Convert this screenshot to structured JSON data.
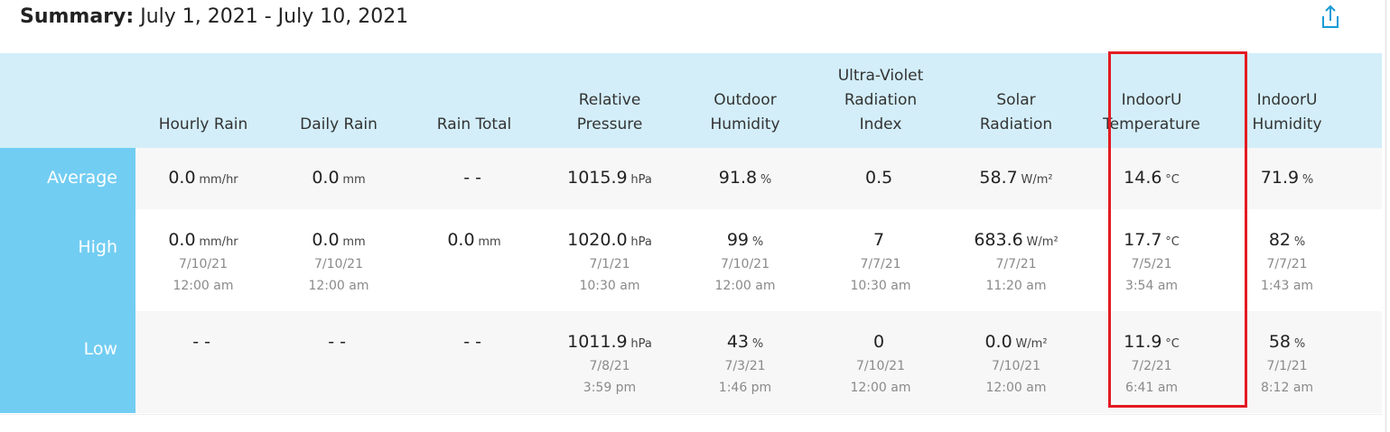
{
  "summary": {
    "label": "Summary:",
    "range": "July 1, 2021 - July 10, 2021",
    "share_icon": "share-icon"
  },
  "columns": [
    {
      "title": "Hourly Rain"
    },
    {
      "title": "Daily Rain"
    },
    {
      "title": "Rain Total"
    },
    {
      "title": "Relative Pressure"
    },
    {
      "title": "Outdoor Humidity"
    },
    {
      "title": "Ultra-Violet Radiation Index"
    },
    {
      "title": "Solar Radiation"
    },
    {
      "title": "IndoorU Temperature"
    },
    {
      "title": "IndoorU Humidity"
    }
  ],
  "rows": {
    "average": {
      "label": "Average",
      "cells": [
        {
          "value": "0.0",
          "unit": "mm/hr"
        },
        {
          "value": "0.0",
          "unit": "mm"
        },
        {
          "value": "- -",
          "unit": ""
        },
        {
          "value": "1015.9",
          "unit": "hPa"
        },
        {
          "value": "91.8",
          "unit": "%"
        },
        {
          "value": "0.5",
          "unit": ""
        },
        {
          "value": "58.7",
          "unit": "W/m²"
        },
        {
          "value": "14.6",
          "unit": "°C"
        },
        {
          "value": "71.9",
          "unit": "%"
        }
      ]
    },
    "high": {
      "label": "High",
      "cells": [
        {
          "value": "0.0",
          "unit": "mm/hr",
          "date": "7/10/21",
          "time": "12:00 am"
        },
        {
          "value": "0.0",
          "unit": "mm",
          "date": "7/10/21",
          "time": "12:00 am"
        },
        {
          "value": "0.0",
          "unit": "mm",
          "date": "",
          "time": ""
        },
        {
          "value": "1020.0",
          "unit": "hPa",
          "date": "7/1/21",
          "time": "10:30 am"
        },
        {
          "value": "99",
          "unit": "%",
          "date": "7/10/21",
          "time": "12:00 am"
        },
        {
          "value": "7",
          "unit": "",
          "date": "7/7/21",
          "time": "10:30 am"
        },
        {
          "value": "683.6",
          "unit": "W/m²",
          "date": "7/7/21",
          "time": "11:20 am"
        },
        {
          "value": "17.7",
          "unit": "°C",
          "date": "7/5/21",
          "time": "3:54 am"
        },
        {
          "value": "82",
          "unit": "%",
          "date": "7/7/21",
          "time": "1:43 am"
        }
      ]
    },
    "low": {
      "label": "Low",
      "cells": [
        {
          "value": "- -",
          "unit": "",
          "date": "",
          "time": ""
        },
        {
          "value": "- -",
          "unit": "",
          "date": "",
          "time": ""
        },
        {
          "value": "- -",
          "unit": "",
          "date": "",
          "time": ""
        },
        {
          "value": "1011.9",
          "unit": "hPa",
          "date": "7/8/21",
          "time": "3:59 pm"
        },
        {
          "value": "43",
          "unit": "%",
          "date": "7/3/21",
          "time": "1:46 pm"
        },
        {
          "value": "0",
          "unit": "",
          "date": "7/10/21",
          "time": "12:00 am"
        },
        {
          "value": "0.0",
          "unit": "W/m²",
          "date": "7/10/21",
          "time": "12:00 am"
        },
        {
          "value": "11.9",
          "unit": "°C",
          "date": "7/2/21",
          "time": "6:41 am"
        },
        {
          "value": "58",
          "unit": "%",
          "date": "7/1/21",
          "time": "8:12 am"
        }
      ]
    }
  },
  "colors": {
    "header_bg": "#d3eef9",
    "label_col_bg": "#72cdf2",
    "highlight_border": "#e31b23",
    "accent": "#1a9ad6"
  }
}
